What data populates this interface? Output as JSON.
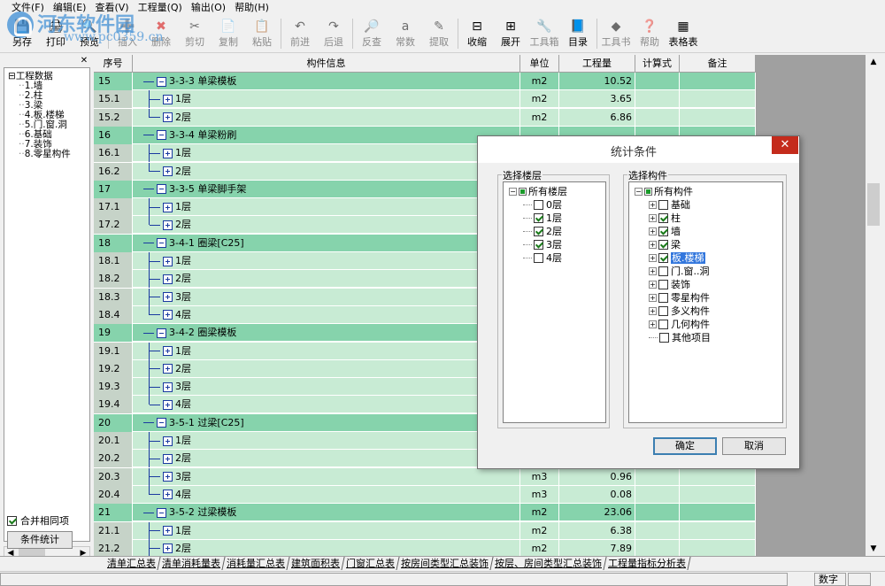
{
  "menu": [
    "文件(F)",
    "编辑(E)",
    "查看(V)",
    "工程量(Q)",
    "输出(O)",
    "帮助(H)"
  ],
  "watermark": {
    "text": "河东软件园",
    "url": "www.pc0359.cn"
  },
  "toolbar": [
    {
      "name": "save-as",
      "label": "另存",
      "icon": "💾",
      "enabled": true
    },
    {
      "name": "print",
      "label": "打印",
      "icon": "🖨",
      "enabled": true
    },
    {
      "name": "preview",
      "label": "预览",
      "icon": "🔍",
      "enabled": true
    },
    {
      "sep": true
    },
    {
      "name": "insert",
      "label": "插入",
      "icon": "➕",
      "enabled": false
    },
    {
      "name": "delete",
      "label": "删除",
      "icon": "✖",
      "enabled": false,
      "color": "#d40000"
    },
    {
      "name": "cut",
      "label": "剪切",
      "icon": "✂",
      "enabled": false
    },
    {
      "name": "copy",
      "label": "复制",
      "icon": "📄",
      "enabled": false
    },
    {
      "name": "paste",
      "label": "粘贴",
      "icon": "📋",
      "enabled": false
    },
    {
      "sep": true
    },
    {
      "name": "forward",
      "label": "前进",
      "icon": "↶",
      "enabled": false
    },
    {
      "name": "back",
      "label": "后退",
      "icon": "↷",
      "enabled": false
    },
    {
      "sep": true
    },
    {
      "name": "check",
      "label": "反查",
      "icon": "🔎",
      "enabled": false
    },
    {
      "name": "constant",
      "label": "常数",
      "icon": "a",
      "enabled": false
    },
    {
      "name": "extract",
      "label": "提取",
      "icon": "✎",
      "enabled": false
    },
    {
      "sep": true
    },
    {
      "name": "collapse",
      "label": "收缩",
      "icon": "⊟",
      "enabled": true
    },
    {
      "name": "expand",
      "label": "展开",
      "icon": "⊞",
      "enabled": true
    },
    {
      "name": "toolbox",
      "label": "工具箱",
      "icon": "🔧",
      "enabled": false
    },
    {
      "name": "catalog",
      "label": "目录",
      "icon": "📘",
      "enabled": true
    },
    {
      "sep": true
    },
    {
      "name": "toolbook",
      "label": "工具书",
      "icon": "◆",
      "enabled": false
    },
    {
      "name": "help",
      "label": "帮助",
      "icon": "❓",
      "enabled": false
    },
    {
      "name": "table-form",
      "label": "表格表",
      "icon": "▦",
      "enabled": true
    }
  ],
  "left_panel": {
    "tree": [
      "工程数据",
      "1.墙",
      "2.柱",
      "3.梁",
      "4.板.楼梯",
      "5.门.窗.洞",
      "6.基础",
      "7.装饰",
      "8.零星构件"
    ],
    "merge_label": "合并相同项",
    "merge_checked": true,
    "stat_button": "条件统计"
  },
  "grid": {
    "headers": [
      "序号",
      "构件信息",
      "单位",
      "工程量",
      "计算式",
      "备注"
    ],
    "rows": [
      {
        "seq": "15",
        "info": "3-3-3  单梁模板",
        "unit": "m2",
        "qty": "10.52",
        "kind": "grp"
      },
      {
        "seq": "15.1",
        "info": "1层",
        "unit": "m2",
        "qty": "3.65",
        "kind": "sub",
        "last": false
      },
      {
        "seq": "15.2",
        "info": "2层",
        "unit": "m2",
        "qty": "6.86",
        "kind": "sub",
        "last": true
      },
      {
        "seq": "16",
        "info": "3-3-4  单梁粉刷",
        "unit": "",
        "qty": "",
        "kind": "grp"
      },
      {
        "seq": "16.1",
        "info": "1层",
        "unit": "",
        "qty": "",
        "kind": "sub",
        "last": false
      },
      {
        "seq": "16.2",
        "info": "2层",
        "unit": "",
        "qty": "",
        "kind": "sub",
        "last": true
      },
      {
        "seq": "17",
        "info": "3-3-5  单梁脚手架",
        "unit": "",
        "qty": "",
        "kind": "grp"
      },
      {
        "seq": "17.1",
        "info": "1层",
        "unit": "",
        "qty": "",
        "kind": "sub",
        "last": false
      },
      {
        "seq": "17.2",
        "info": "2层",
        "unit": "",
        "qty": "",
        "kind": "sub",
        "last": true
      },
      {
        "seq": "18",
        "info": "3-4-1  圈梁[C25]",
        "unit": "",
        "qty": "",
        "kind": "grp"
      },
      {
        "seq": "18.1",
        "info": "1层",
        "unit": "",
        "qty": "",
        "kind": "sub",
        "last": false
      },
      {
        "seq": "18.2",
        "info": "2层",
        "unit": "",
        "qty": "",
        "kind": "sub",
        "last": false
      },
      {
        "seq": "18.3",
        "info": "3层",
        "unit": "",
        "qty": "",
        "kind": "sub",
        "last": false
      },
      {
        "seq": "18.4",
        "info": "4层",
        "unit": "",
        "qty": "",
        "kind": "sub",
        "last": true
      },
      {
        "seq": "19",
        "info": "3-4-2  圈梁模板",
        "unit": "",
        "qty": "",
        "kind": "grp"
      },
      {
        "seq": "19.1",
        "info": "1层",
        "unit": "",
        "qty": "",
        "kind": "sub",
        "last": false
      },
      {
        "seq": "19.2",
        "info": "2层",
        "unit": "",
        "qty": "",
        "kind": "sub",
        "last": false
      },
      {
        "seq": "19.3",
        "info": "3层",
        "unit": "",
        "qty": "",
        "kind": "sub",
        "last": false
      },
      {
        "seq": "19.4",
        "info": "4层",
        "unit": "",
        "qty": "",
        "kind": "sub",
        "last": true
      },
      {
        "seq": "20",
        "info": "3-5-1  过梁[C25]",
        "unit": "",
        "qty": "",
        "kind": "grp"
      },
      {
        "seq": "20.1",
        "info": "1层",
        "unit": "",
        "qty": "",
        "kind": "sub",
        "last": false
      },
      {
        "seq": "20.2",
        "info": "2层",
        "unit": "",
        "qty": "",
        "kind": "sub",
        "last": false
      },
      {
        "seq": "20.3",
        "info": "3层",
        "unit": "m3",
        "qty": "0.96",
        "kind": "sub",
        "last": false
      },
      {
        "seq": "20.4",
        "info": "4层",
        "unit": "m3",
        "qty": "0.08",
        "kind": "sub",
        "last": true
      },
      {
        "seq": "21",
        "info": "3-5-2  过梁模板",
        "unit": "m2",
        "qty": "23.06",
        "kind": "grp"
      },
      {
        "seq": "21.1",
        "info": "1层",
        "unit": "m2",
        "qty": "6.38",
        "kind": "sub",
        "last": false
      },
      {
        "seq": "21.2",
        "info": "2层",
        "unit": "m2",
        "qty": "7.89",
        "kind": "sub",
        "last": false
      }
    ]
  },
  "dialog": {
    "title": "统计条件",
    "floor_label": "选择楼层",
    "floors_root": "所有楼层",
    "floors": [
      {
        "label": "0层",
        "checked": false
      },
      {
        "label": "1层",
        "checked": true
      },
      {
        "label": "2层",
        "checked": true
      },
      {
        "label": "3层",
        "checked": true
      },
      {
        "label": "4层",
        "checked": false
      }
    ],
    "comp_label": "选择构件",
    "comp_root": "所有构件",
    "components": [
      {
        "label": "基础",
        "checked": false,
        "expandable": true,
        "selected": false
      },
      {
        "label": "柱",
        "checked": true,
        "expandable": true,
        "selected": false
      },
      {
        "label": "墙",
        "checked": true,
        "expandable": true,
        "selected": false
      },
      {
        "label": "梁",
        "checked": true,
        "expandable": true,
        "selected": false
      },
      {
        "label": "板.楼梯",
        "checked": true,
        "expandable": true,
        "selected": true
      },
      {
        "label": "门.窗..洞",
        "checked": false,
        "expandable": true,
        "selected": false
      },
      {
        "label": "装饰",
        "checked": false,
        "expandable": true,
        "selected": false
      },
      {
        "label": "零星构件",
        "checked": false,
        "expandable": true,
        "selected": false
      },
      {
        "label": "多义构件",
        "checked": false,
        "expandable": true,
        "selected": false
      },
      {
        "label": "几何构件",
        "checked": false,
        "expandable": true,
        "selected": false
      },
      {
        "label": "其他项目",
        "checked": false,
        "expandable": false,
        "selected": false
      }
    ],
    "ok": "确定",
    "cancel": "取消"
  },
  "tabs": [
    "清单汇总表",
    "清单消耗量表",
    "消耗量汇总表",
    "建筑面积表",
    "门窗汇总表",
    "按房间类型汇总装饰",
    "按层、房间类型汇总装饰",
    "工程量指标分析表"
  ],
  "status": {
    "mode": "数字"
  }
}
